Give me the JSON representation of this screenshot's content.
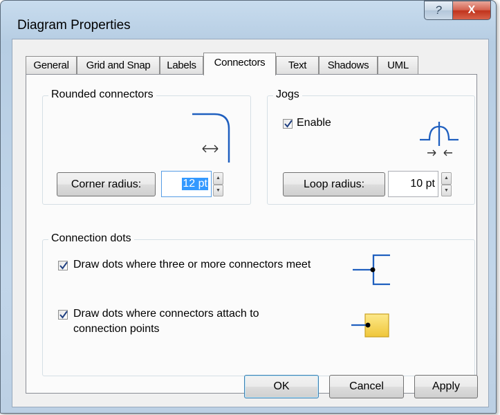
{
  "window": {
    "title": "Diagram Properties"
  },
  "titlebar": {
    "help_icon": "?",
    "close_icon": "X"
  },
  "tabs": [
    {
      "label": "General"
    },
    {
      "label": "Grid and Snap"
    },
    {
      "label": "Labels"
    },
    {
      "label": "Connectors",
      "active": true
    },
    {
      "label": "Text"
    },
    {
      "label": "Shadows"
    },
    {
      "label": "UML"
    }
  ],
  "rounded": {
    "label": "Rounded connectors",
    "button": "Corner radius:",
    "value": "12 pt"
  },
  "jogs": {
    "label": "Jogs",
    "enable_label": "Enable",
    "enable_checked": true,
    "button": "Loop radius:",
    "value": "10 pt"
  },
  "dots": {
    "label": "Connection dots",
    "option1": "Draw dots where three or more connectors meet",
    "option2_line1": "Draw dots where connectors attach to",
    "option2_line2": "connection points",
    "option1_checked": true,
    "option2_checked": true
  },
  "footer": {
    "ok": "OK",
    "cancel": "Cancel",
    "apply": "Apply"
  },
  "colors": {
    "accent_blue": "#1f5fbf",
    "dot_yellow": "#f5d54a"
  }
}
